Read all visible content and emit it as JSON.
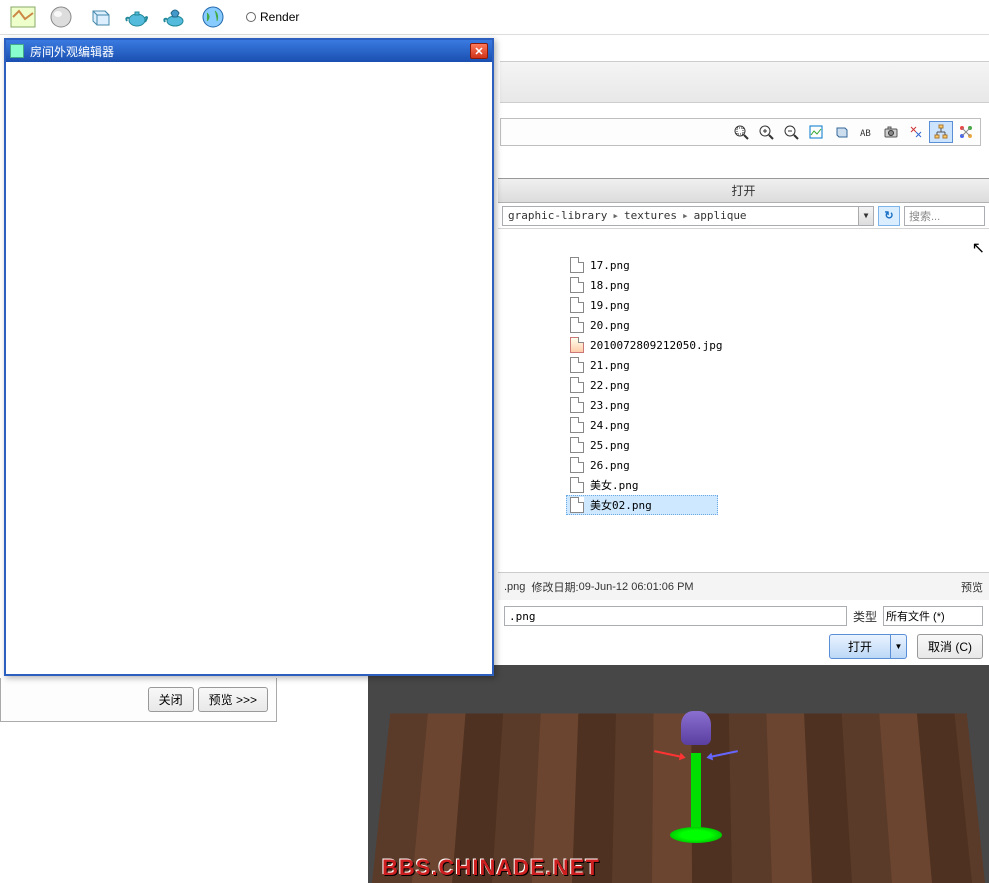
{
  "top_toolbar": {
    "render_label": "Render",
    "icons": [
      "map-icon",
      "sphere-icon",
      "cube-icon",
      "teapot-icon",
      "teapot-hat-icon",
      "globe-icon"
    ]
  },
  "appearance_dialog": {
    "title": "房间外观编辑器"
  },
  "lower_left": {
    "close_label": "关闭",
    "preview_label": "预览 >>>"
  },
  "icon_strip": {
    "items": [
      "zoom-fit",
      "zoom-in",
      "zoom-out",
      "snapshot",
      "box",
      "ab-text",
      "camera",
      "xx-tool",
      "hierarchy",
      "nodes"
    ]
  },
  "open_dialog": {
    "title": "打开",
    "breadcrumb": {
      "parts": [
        "graphic-library",
        "textures",
        "applique"
      ]
    },
    "search_placeholder": "搜索...",
    "files": [
      {
        "name": "17.png",
        "type": "png"
      },
      {
        "name": "18.png",
        "type": "png"
      },
      {
        "name": "19.png",
        "type": "png"
      },
      {
        "name": "20.png",
        "type": "png"
      },
      {
        "name": "2010072809212050.jpg",
        "type": "jpg"
      },
      {
        "name": "21.png",
        "type": "png"
      },
      {
        "name": "22.png",
        "type": "png"
      },
      {
        "name": "23.png",
        "type": "png"
      },
      {
        "name": "24.png",
        "type": "png"
      },
      {
        "name": "25.png",
        "type": "png"
      },
      {
        "name": "26.png",
        "type": "png"
      },
      {
        "name": "美女.png",
        "type": "png"
      },
      {
        "name": "美女02.png",
        "type": "png",
        "selected": true
      }
    ],
    "status": {
      "ext_label": ".png",
      "mod_label": "修改日期:",
      "mod_value": "09-Jun-12 06:01:06 PM",
      "preview_label": "预览"
    },
    "filename_value": ".png",
    "type_label": "类型",
    "type_value": "所有文件 (*)",
    "open_button": "打开",
    "cancel_button": "取消 (C)"
  },
  "viewport": {
    "watermark": "BBS.CHINADE.NET"
  }
}
